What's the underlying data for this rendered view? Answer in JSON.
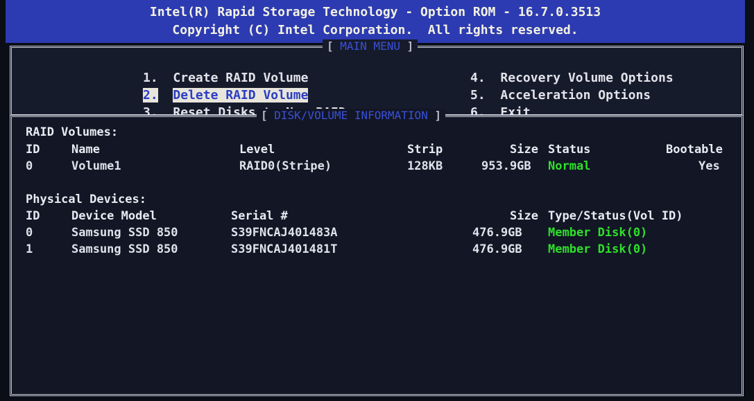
{
  "header": {
    "title": "Intel(R) Rapid Storage Technology - Option ROM - 16.7.0.3513",
    "copyright": "Copyright (C) Intel Corporation.  All rights reserved."
  },
  "main_menu": {
    "title": "MAIN MENU",
    "items": [
      {
        "num": "1.",
        "label": "Create RAID Volume"
      },
      {
        "num": "2.",
        "label": "Delete RAID Volume"
      },
      {
        "num": "3.",
        "label": "Reset Disks to Non-RAID"
      },
      {
        "num": "4.",
        "label": "Recovery Volume Options"
      },
      {
        "num": "5.",
        "label": "Acceleration Options"
      },
      {
        "num": "6.",
        "label": "Exit"
      }
    ],
    "selected_index": 1
  },
  "info": {
    "title": "DISK/VOLUME INFORMATION",
    "raid_volumes": {
      "heading": "RAID Volumes:",
      "columns": [
        "ID",
        "Name",
        "Level",
        "Strip",
        "Size",
        "Status",
        "Bootable"
      ],
      "rows": [
        {
          "id": "0",
          "name": "Volume1",
          "level": "RAID0(Stripe)",
          "strip": "128KB",
          "size": "953.9GB",
          "status": "Normal",
          "bootable": "Yes"
        }
      ]
    },
    "physical_devices": {
      "heading": "Physical Devices:",
      "columns": [
        "ID",
        "Device Model",
        "Serial #",
        "Size",
        "Type/Status(Vol ID)"
      ],
      "rows": [
        {
          "id": "0",
          "model": "Samsung SSD 850",
          "serial": "S39FNCAJ401483A",
          "size": "476.9GB",
          "type_status": "Member Disk(0)"
        },
        {
          "id": "1",
          "model": "Samsung SSD 850",
          "serial": "S39FNCAJ401481T",
          "size": "476.9GB",
          "type_status": "Member Disk(0)"
        }
      ]
    }
  },
  "colors": {
    "header_bg": "#2c3bb1",
    "status_green": "#2fe02a",
    "selection_bg": "#e8e5dc",
    "selection_fg": "#2b3ec2"
  }
}
